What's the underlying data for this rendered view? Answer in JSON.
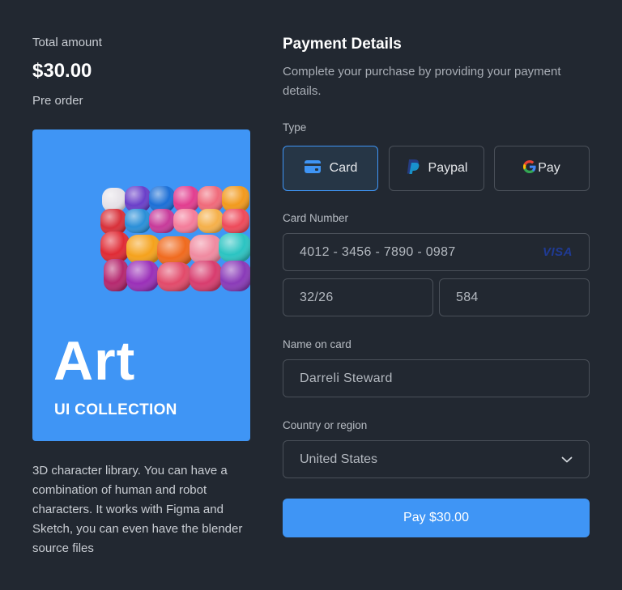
{
  "summary": {
    "total_label": "Total amount",
    "total_amount": "$30.00",
    "status": "Pre order"
  },
  "product": {
    "title": "Art",
    "subtitle": "UI COLLECTION",
    "card_color": "#3f95f5",
    "image_icon": "colorful-puffy-sofa",
    "description": "3D character library. You can have a combination of human and robot characters. It works with Figma and Sketch, you can even have the blender source files"
  },
  "payment": {
    "title": "Payment Details",
    "subtitle": "Complete your purchase by providing your payment details.",
    "type_label": "Type",
    "types": [
      {
        "label": "Card",
        "icon": "card-icon",
        "active": true
      },
      {
        "label": "Paypal",
        "icon": "paypal-icon",
        "active": false
      },
      {
        "label": "Pay",
        "icon": "google-g-icon",
        "active": false
      }
    ],
    "card_number_label": "Card Number",
    "card_number": "4012 - 3456 - 7890 - 0987",
    "card_brand": "VISA",
    "expiry": "32/26",
    "cvc": "584",
    "name_label": "Name on card",
    "name_value": "Darreli Steward",
    "country_label": "Country or region",
    "country_value": "United States",
    "pay_button": "Pay $30.00",
    "accent_color": "#3f95f5"
  }
}
